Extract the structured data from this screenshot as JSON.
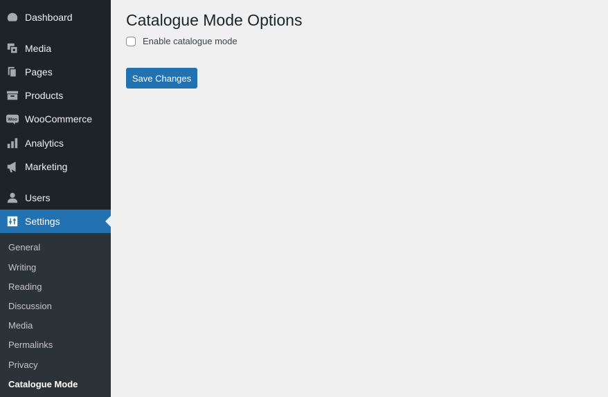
{
  "sidebar": {
    "items": [
      {
        "label": "Dashboard",
        "icon": "dashboard-icon"
      },
      {
        "label": "Media",
        "icon": "media-icon"
      },
      {
        "label": "Pages",
        "icon": "pages-icon"
      },
      {
        "label": "Products",
        "icon": "products-icon"
      },
      {
        "label": "WooCommerce",
        "icon": "woocommerce-icon"
      },
      {
        "label": "Analytics",
        "icon": "analytics-icon"
      },
      {
        "label": "Marketing",
        "icon": "marketing-icon"
      },
      {
        "label": "Users",
        "icon": "users-icon"
      },
      {
        "label": "Settings",
        "icon": "settings-icon"
      }
    ],
    "active": "Settings",
    "submenu": [
      "General",
      "Writing",
      "Reading",
      "Discussion",
      "Media",
      "Permalinks",
      "Privacy",
      "Catalogue Mode"
    ],
    "current_sub": "Catalogue Mode"
  },
  "main": {
    "title": "Catalogue Mode Options",
    "checkbox_label": "Enable catalogue mode",
    "checkbox_checked": false,
    "save_label": "Save Changes"
  },
  "colors": {
    "sidebar_bg": "#1d2327",
    "submenu_bg": "#2c3338",
    "accent": "#2271b1",
    "page_bg": "#f0f0f1"
  }
}
